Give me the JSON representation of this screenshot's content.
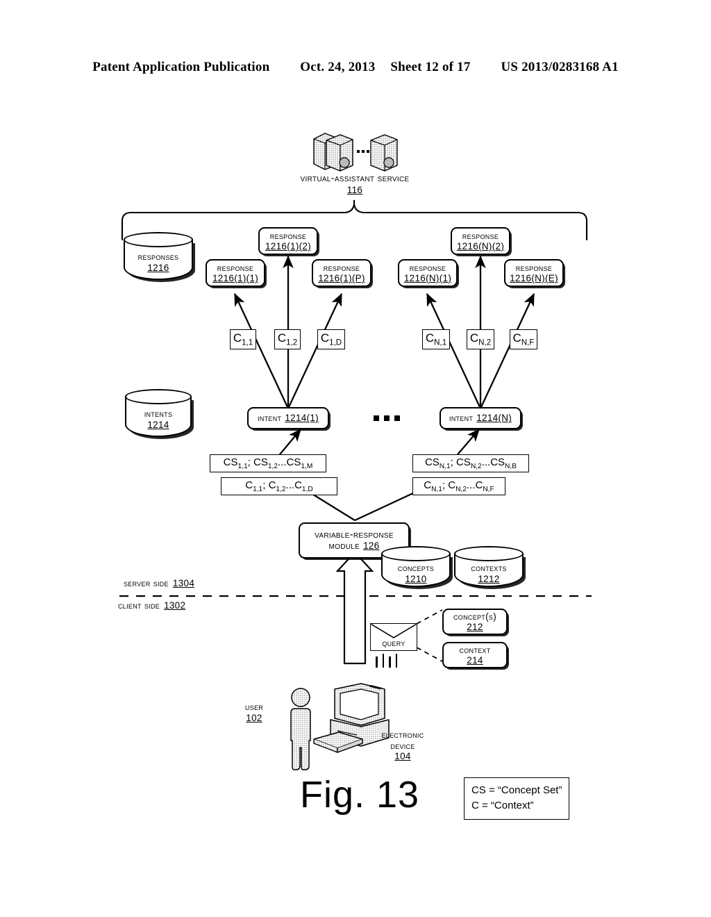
{
  "header": {
    "publication": "Patent Application Publication",
    "date": "Oct. 24, 2013",
    "sheet": "Sheet 12 of 17",
    "number": "US 2013/0283168 A1"
  },
  "figure": {
    "caption": "Fig. 13",
    "legend_line_1": "CS = “Concept Set”",
    "legend_line_2": "C = “Context”"
  },
  "service": {
    "label": "Virtual-Assistant Service",
    "ref": "116",
    "ellipsis": "•••"
  },
  "databases": {
    "responses": {
      "label": "Responses",
      "ref": "1216"
    },
    "intents": {
      "label": "Intents",
      "ref": "1214"
    },
    "concepts": {
      "label": "Concepts",
      "ref": "1210"
    },
    "contexts": {
      "label": "Contexts",
      "ref": "1212"
    }
  },
  "responses_group_1": [
    {
      "label": "Response",
      "ref": "1216(1)(1)"
    },
    {
      "label": "Response",
      "ref": "1216(1)(2)"
    },
    {
      "label": "Response",
      "ref": "1216(1)(P)"
    }
  ],
  "responses_group_n": [
    {
      "label": "Response",
      "ref": "1216(N)(1)"
    },
    {
      "label": "Response",
      "ref": "1216(N)(2)"
    },
    {
      "label": "Response",
      "ref": "1216(N)(E)"
    }
  ],
  "context_labels_1": [
    {
      "base": "C",
      "sub": "1,1"
    },
    {
      "base": "C",
      "sub": "1,2"
    },
    {
      "base": "C",
      "sub": "1,D"
    }
  ],
  "context_labels_n": [
    {
      "base": "C",
      "sub": "N,1"
    },
    {
      "base": "C",
      "sub": "N,2"
    },
    {
      "base": "C",
      "sub": "N,F"
    }
  ],
  "intents": {
    "first": {
      "label": "Intent",
      "ref": "1214(1)"
    },
    "last": {
      "label": "Intent",
      "ref": "1214(N)"
    }
  },
  "concept_sets": {
    "left_cs": "CS1,1; CS1,2...CS1,M",
    "left_c": "C1,1; C1,2...C1,D",
    "right_cs": "CSN,1; CSN,2...CSN,B",
    "right_c": "CN,1; CN,2...CN,F"
  },
  "module": {
    "line1": "Variable-Response",
    "line2": "Module",
    "ref": "126"
  },
  "divider": {
    "server": "Server Side",
    "server_ref": "1304",
    "client": "Client Side",
    "client_ref": "1302"
  },
  "query": {
    "label": "Query",
    "concepts_label": "Concept(s)",
    "concepts_ref": "212",
    "context_label": "Context",
    "context_ref": "214"
  },
  "actors": {
    "user_label": "User",
    "user_ref": "102",
    "device_line1": "Electronic",
    "device_line2": "Device",
    "device_ref": "104"
  }
}
